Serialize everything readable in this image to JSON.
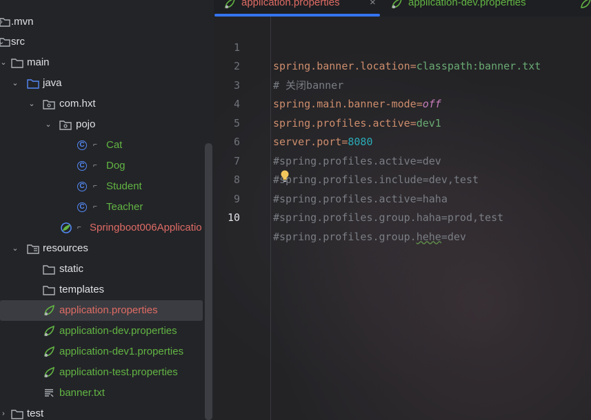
{
  "project_tree": {
    "items": [
      {
        "label": ".mvn",
        "icon": "folder-icon",
        "expanded": false
      },
      {
        "label": "src",
        "icon": "folder-icon",
        "expanded": true
      },
      {
        "label": "main",
        "icon": "folder-icon",
        "expanded": true
      },
      {
        "label": "java",
        "icon": "source-folder-icon",
        "expanded": true
      },
      {
        "label": "com.hxt",
        "icon": "package-icon",
        "expanded": true
      },
      {
        "label": "pojo",
        "icon": "package-icon",
        "expanded": true
      },
      {
        "label": "Cat",
        "icon": "class-icon"
      },
      {
        "label": "Dog",
        "icon": "class-icon"
      },
      {
        "label": "Student",
        "icon": "class-icon"
      },
      {
        "label": "Teacher",
        "icon": "class-icon"
      },
      {
        "label": "Springboot006Applicatio",
        "icon": "spring-boot-class-icon"
      },
      {
        "label": "resources",
        "icon": "resources-folder-icon",
        "expanded": true
      },
      {
        "label": "static",
        "icon": "folder-icon"
      },
      {
        "label": "templates",
        "icon": "folder-icon"
      },
      {
        "label": "application.properties",
        "icon": "spring-properties-icon",
        "selected": true
      },
      {
        "label": "application-dev.properties",
        "icon": "spring-properties-icon"
      },
      {
        "label": "application-dev1.properties",
        "icon": "spring-properties-icon"
      },
      {
        "label": "application-test.properties",
        "icon": "spring-properties-icon"
      },
      {
        "label": "banner.txt",
        "icon": "text-file-icon"
      },
      {
        "label": "test",
        "icon": "folder-icon",
        "expanded": false
      }
    ]
  },
  "tabs": [
    {
      "label": "application.properties",
      "active": true,
      "icon": "spring-properties-icon",
      "close": "×"
    },
    {
      "label": "application-dev.properties",
      "active": false,
      "icon": "spring-properties-icon"
    }
  ],
  "editor": {
    "current_line": 10,
    "lines": [
      {
        "num": "1",
        "text": "spring.banner.location=classpath:banner.txt"
      },
      {
        "num": "2",
        "text": "# 关闭banner"
      },
      {
        "num": "3",
        "text": "spring.main.banner-mode=off"
      },
      {
        "num": "4",
        "text": "spring.profiles.active=dev1"
      },
      {
        "num": "5",
        "text": "server.port=8080"
      },
      {
        "num": "6",
        "text": "#spring.profiles.active=dev"
      },
      {
        "num": "7",
        "text": "#spring.profiles.include=dev,test"
      },
      {
        "num": "8",
        "text": "#spring.profiles.active=haha"
      },
      {
        "num": "9",
        "text": "#spring.profiles.group.haha=prod,test"
      },
      {
        "num": "10",
        "text": "#spring.profiles.group.hehe=dev"
      }
    ],
    "gutter_icon": "lightbulb-icon"
  },
  "colors": {
    "background": "#1e1f22",
    "accent": "#3574f0",
    "key": "#cf8e6d",
    "value": "#6aab73",
    "number": "#2aacb8",
    "comment": "#7a7e85",
    "keyword_italic": "#c77dbb",
    "vcs_added": "#62b543",
    "vcs_error": "#e06c65"
  }
}
